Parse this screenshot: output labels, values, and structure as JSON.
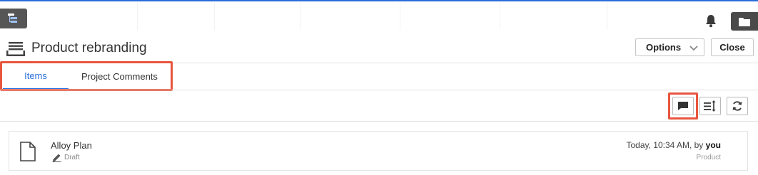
{
  "header": {
    "title": "Product rebranding",
    "options_label": "Options",
    "close_label": "Close"
  },
  "tabs": [
    {
      "label": "Items",
      "active": true
    },
    {
      "label": "Project Comments",
      "active": false
    }
  ],
  "toolbar": {
    "comment_icon": "comment-icon",
    "sort_icon": "sort-icon",
    "refresh_icon": "refresh-icon"
  },
  "items": [
    {
      "title": "Alloy Plan",
      "status": "Draft",
      "modified_prefix": "Today, 10:34 AM, by",
      "modified_by": "you",
      "type": "Product"
    }
  ],
  "colors": {
    "accent": "#2a6edb",
    "highlight": "#e8553e",
    "dark_button": "#4a4a4a"
  }
}
